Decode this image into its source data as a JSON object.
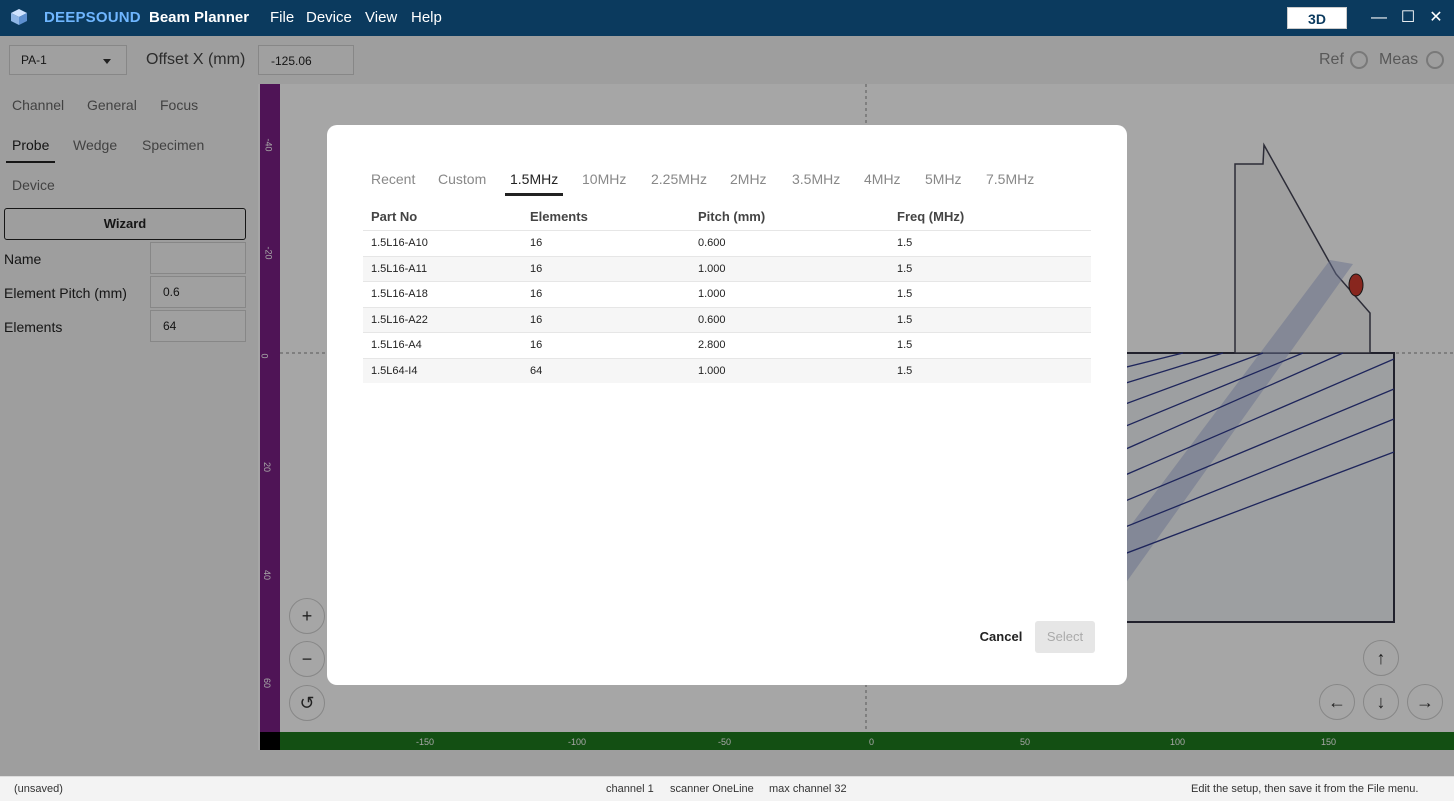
{
  "titlebar": {
    "brand": "DEEPSOUND",
    "app_title": "Beam Planner",
    "menu": [
      "File",
      "Device",
      "View",
      "Help"
    ],
    "view_mode_button": "3D",
    "controls": {
      "minimize": "—",
      "maximize": "☐",
      "close": "✕"
    }
  },
  "toolbar": {
    "channel_select": "PA-1",
    "offset_label": "Offset X (mm)",
    "offset_value": "-125.06",
    "ref_label": "Ref",
    "meas_label": "Meas"
  },
  "sidebar": {
    "tabs_row1": [
      "Channel",
      "General",
      "Focus"
    ],
    "tabs_row2": [
      "Probe",
      "Wedge",
      "Specimen"
    ],
    "tabs_row3": [
      "Device"
    ],
    "active_tab": "Probe",
    "wizard_label": "Wizard",
    "fields": [
      {
        "label": "Name",
        "value": ""
      },
      {
        "label": "Element Pitch (mm)",
        "value": "0.6"
      },
      {
        "label": "Elements",
        "value": "64"
      }
    ]
  },
  "canvas": {
    "h_ruler_labels": [
      "-150",
      "-100",
      "-50",
      "0",
      "50",
      "100",
      "150"
    ],
    "v_ruler_labels": [
      "-40",
      "-20",
      "0",
      "20",
      "40",
      "60"
    ],
    "zoom_in": "+",
    "zoom_out": "−",
    "reset": "↺",
    "pan": {
      "up": "↑",
      "down": "↓",
      "left": "←",
      "right": "→"
    }
  },
  "dialog": {
    "tabs": [
      "Recent",
      "Custom",
      "1.5MHz",
      "10MHz",
      "2.25MHz",
      "2MHz",
      "3.5MHz",
      "4MHz",
      "5MHz",
      "7.5MHz"
    ],
    "active_tab": "1.5MHz",
    "columns": [
      "Part No",
      "Elements",
      "Pitch (mm)",
      "Freq (MHz)"
    ],
    "rows": [
      [
        "1.5L16-A10",
        "16",
        "0.600",
        "1.5"
      ],
      [
        "1.5L16-A11",
        "16",
        "1.000",
        "1.5"
      ],
      [
        "1.5L16-A18",
        "16",
        "1.000",
        "1.5"
      ],
      [
        "1.5L16-A22",
        "16",
        "0.600",
        "1.5"
      ],
      [
        "1.5L16-A4",
        "16",
        "2.800",
        "1.5"
      ],
      [
        "1.5L64-I4",
        "64",
        "1.000",
        "1.5"
      ]
    ],
    "cancel_label": "Cancel",
    "select_label": "Select"
  },
  "statusbar": {
    "file_state": "(unsaved)",
    "channel": "channel 1",
    "scanner": "scanner OneLine",
    "max_channel": "max channel 32",
    "hint": "Edit the setup, then save it from the File menu."
  }
}
